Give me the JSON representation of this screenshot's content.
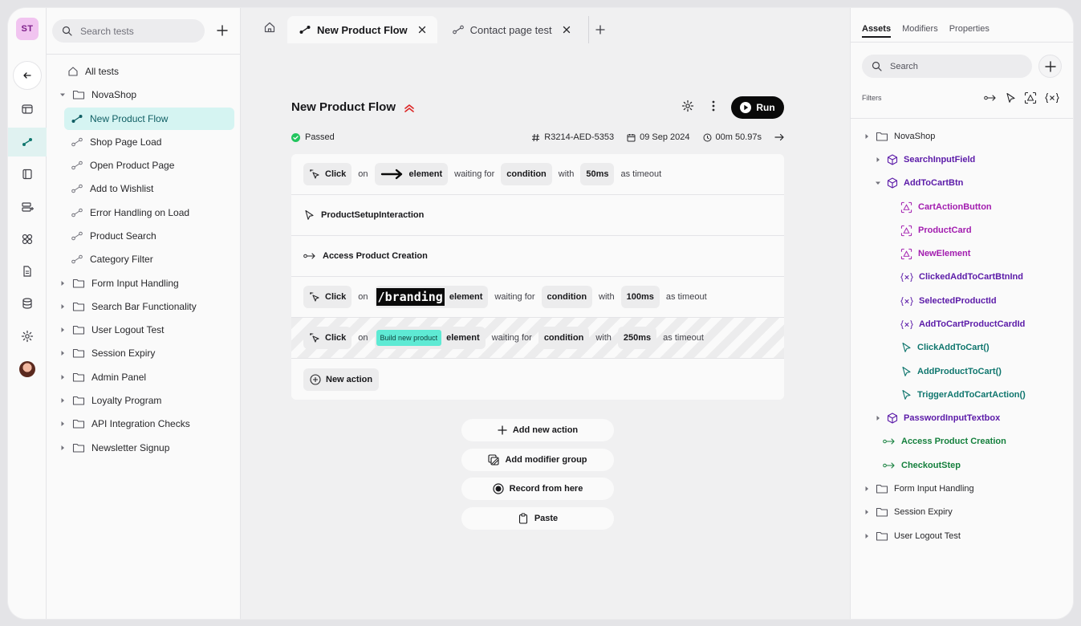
{
  "rail": {
    "workspace_initials": "ST"
  },
  "tree": {
    "search_placeholder": "Search tests",
    "all_tests": "All tests",
    "root_folder": "NovaShop",
    "tests": [
      "New Product Flow",
      "Shop Page Load",
      "Open Product Page",
      "Add to Wishlist",
      "Error Handling on Load",
      "Product Search",
      "Category Filter"
    ],
    "folders": [
      "Form Input Handling",
      "Search Bar Functionality",
      "User Logout Test",
      "Session Expiry",
      "Admin Panel",
      "Loyalty Program",
      "API Integration Checks",
      "Newsletter Signup"
    ]
  },
  "tabs": [
    {
      "label": "New Product Flow"
    },
    {
      "label": "Contact page test"
    }
  ],
  "flow": {
    "title": "New Product Flow",
    "run_label": "Run",
    "status": "Passed",
    "run_id": "R3214-AED-5353",
    "date": "09 Sep 2024",
    "duration": "00m 50.97s"
  },
  "steps": {
    "s1": {
      "action": "Click",
      "on": "on",
      "element": "element",
      "waiting": "waiting for",
      "condition": "condition",
      "with": "with",
      "timeout": "50ms",
      "as_timeout": "as timeout"
    },
    "s2": {
      "label": "ProductSetupInteraction"
    },
    "s3": {
      "label": "Access Product Creation"
    },
    "s4": {
      "action": "Click",
      "on": "on",
      "thumb_text": "/branding",
      "element": "element",
      "waiting": "waiting for",
      "condition": "condition",
      "with": "with",
      "timeout": "100ms",
      "as_timeout": "as timeout"
    },
    "s5": {
      "action": "Click",
      "on": "on",
      "thumb_text": "Build new product",
      "element": "element",
      "waiting": "waiting for",
      "condition": "condition",
      "with": "with",
      "timeout": "250ms",
      "as_timeout": "as timeout"
    },
    "new_action": "New action"
  },
  "actions": {
    "add_new_action": "Add new action",
    "add_modifier_group": "Add modifier group",
    "record_from_here": "Record from here",
    "paste": "Paste"
  },
  "assets": {
    "tabs": [
      "Assets",
      "Modifiers",
      "Properties"
    ],
    "search_placeholder": "Search",
    "filters_label": "Filters",
    "root": "NovaShop",
    "search_input_field": "SearchInputField",
    "add_to_cart_btn": "AddToCartBtn",
    "children": {
      "cart_action_button": "CartActionButton",
      "product_card": "ProductCard",
      "new_element": "NewElement",
      "clicked_id": "ClickedAddToCartBtnInd",
      "selected_id": "SelectedProductId",
      "card_id": "AddToCartProductCardId",
      "click_add": "ClickAddToCart()",
      "add_product": "AddProductToCart()",
      "trigger": "TriggerAddToCartAction()"
    },
    "password_input": "PasswordInputTextbox",
    "access_product_creation": "Access Product Creation",
    "checkout_step": "CheckoutStep",
    "folders": [
      "Form Input Handling",
      "Session Expiry",
      "User Logout Test"
    ]
  },
  "colors": {
    "accent_teal": "#14b8a6",
    "selected_bg": "#d5f4f2",
    "purple": "#5b1aa8",
    "magenta": "#a21caf",
    "teal": "#0f766e",
    "green": "#15803d",
    "error_red": "#dc2626"
  }
}
